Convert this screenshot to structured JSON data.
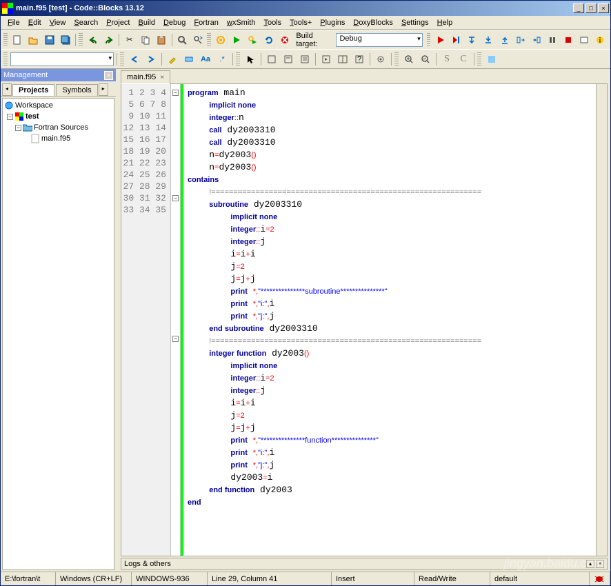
{
  "title": "main.f95 [test] - Code::Blocks 13.12",
  "menus": [
    "File",
    "Edit",
    "View",
    "Search",
    "Project",
    "Build",
    "Debug",
    "Fortran",
    "wxSmith",
    "Tools",
    "Tools+",
    "Plugins",
    "DoxyBlocks",
    "Settings",
    "Help"
  ],
  "build_target_label": "Build target:",
  "build_target_value": "Debug",
  "mgmt": {
    "title": "Management",
    "tabs": [
      "Projects",
      "Symbols"
    ],
    "tree": {
      "root": "Workspace",
      "project": "test",
      "folder": "Fortran Sources",
      "file": "main.f95"
    }
  },
  "editor": {
    "tab": "main.f95",
    "line_count": 35,
    "code_html": "<span class='kw'>program</span> main\n    <span class='kw'>implicit none</span>\n    <span class='kw'>integer</span><span class='op'>::</span>n\n    <span class='kw'>call</span> dy2003310\n    <span class='kw'>call</span> dy2003310\n    n<span class='op'>=</span>dy2003<span class='op'>()</span>\n    n<span class='op'>=</span>dy2003<span class='op'>()</span>\n<span class='kw'>contains</span>\n    <span class='cmt'>!=============================================================</span>\n    <span class='kw'>subroutine</span> dy2003310\n        <span class='kw'>implicit none</span>\n        <span class='kw'>integer</span><span class='op'>::</span>i<span class='op'>=</span><span class='num'>2</span>\n        <span class='kw'>integer</span><span class='op'>::</span>j\n        i<span class='op'>=</span>i<span class='op'>+</span>i\n        j<span class='op'>=</span><span class='num'>2</span>\n        j<span class='op'>=</span>j<span class='op'>+</span>j\n        <span class='kw'>print</span> <span class='op'>*,</span><span class='str'>\"***************subroutine***************\"</span>\n        <span class='kw'>print</span> <span class='op'>*,</span><span class='str'>\"i:\"</span><span class='op'>,</span>i\n        <span class='kw'>print</span> <span class='op'>*,</span><span class='str'>\"j:\"</span><span class='op'>,</span>j\n    <span class='kw'>end subroutine</span> dy2003310\n    <span class='cmt'>!=============================================================</span>\n    <span class='kw'>integer function</span> dy2003<span class='op'>()</span>\n        <span class='kw'>implicit none</span>\n        <span class='kw'>integer</span><span class='op'>::</span>i<span class='op'>=</span><span class='num'>2</span>\n        <span class='kw'>integer</span><span class='op'>::</span>j\n        i<span class='op'>=</span>i<span class='op'>+</span>i\n        j<span class='op'>=</span><span class='num'>2</span>\n        j<span class='op'>=</span>j<span class='op'>+</span>j\n        <span class='kw'>print</span> <span class='op'>*,</span><span class='str'>\"***************function***************\"</span>\n        <span class='kw'>print</span> <span class='op'>*,</span><span class='str'>\"i:\"</span><span class='op'>,</span>i\n        <span class='kw'>print</span> <span class='op'>*,</span><span class='str'>\"j:\"</span><span class='op'>,</span>j\n        dy2003<span class='op'>=</span>i\n    <span class='kw'>end function</span> dy2003\n<span class='kw'>end</span>\n"
  },
  "logs_label": "Logs & others",
  "status": {
    "path": "E:\\fortran\\t",
    "eol": "Windows (CR+LF)",
    "encoding": "WINDOWS-936",
    "cursor": "Line 29, Column 41",
    "mode": "Insert",
    "rw": "Read/Write",
    "profile": "default"
  },
  "watermark": "jingyan.baidu.com"
}
